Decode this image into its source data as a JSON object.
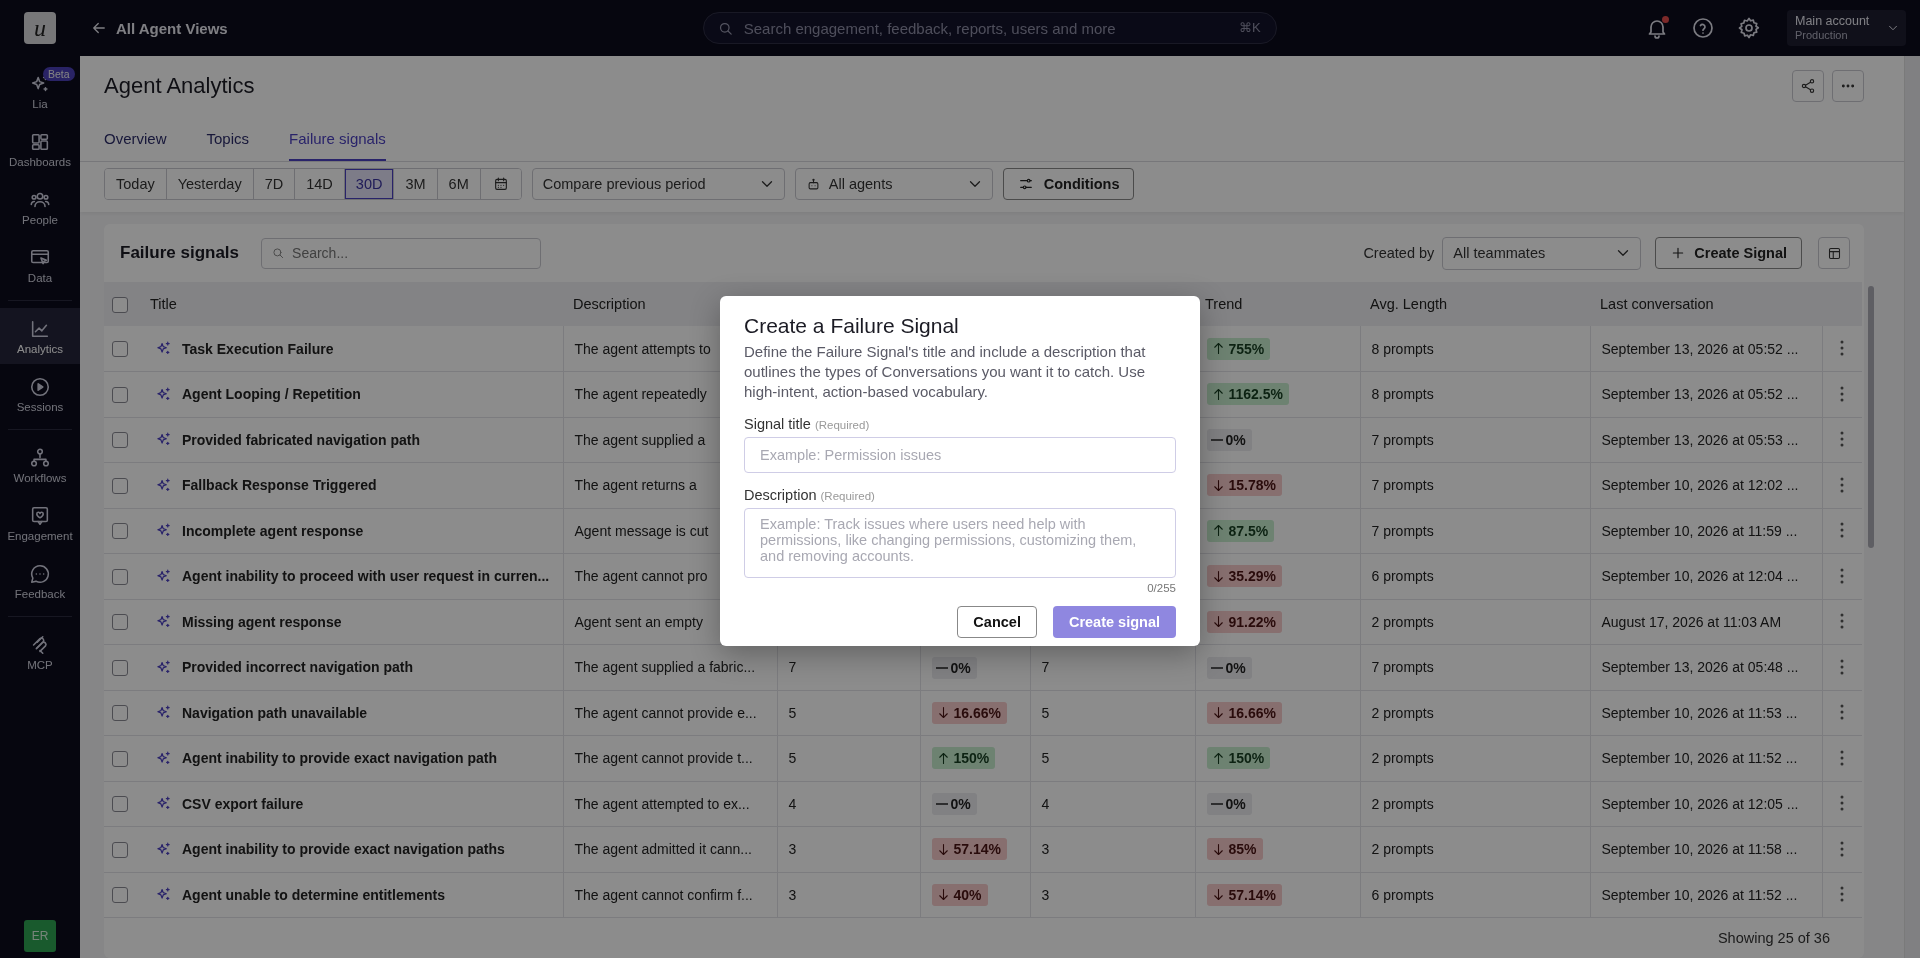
{
  "topbar": {
    "logo": "u",
    "back_link": "All Agent Views",
    "search": {
      "placeholder": "Search engagement, feedback, reports, users and more",
      "shortcut": "⌘K"
    },
    "notifications": {
      "unread": true
    },
    "account": {
      "name": "Main account",
      "environment": "Production"
    }
  },
  "sidebar": {
    "groups": [
      [
        {
          "label": "Lia",
          "badge": "Beta",
          "selected": false
        },
        {
          "label": "Dashboards",
          "selected": false
        },
        {
          "label": "People",
          "selected": false
        },
        {
          "label": "Data",
          "selected": false
        }
      ],
      [
        {
          "label": "Analytics",
          "selected": true
        },
        {
          "label": "Sessions",
          "selected": false
        }
      ],
      [
        {
          "label": "Workflows",
          "selected": false
        },
        {
          "label": "Engagement",
          "selected": false
        },
        {
          "label": "Feedback",
          "selected": false
        }
      ],
      [
        {
          "label": "MCP",
          "selected": false
        }
      ]
    ],
    "user_initials": "ER"
  },
  "page": {
    "title": "Agent Analytics",
    "tabs": [
      {
        "label": "Overview",
        "selected": false
      },
      {
        "label": "Topics",
        "selected": false
      },
      {
        "label": "Failure signals",
        "selected": true
      }
    ]
  },
  "filters": {
    "ranges": [
      {
        "label": "Today",
        "selected": false
      },
      {
        "label": "Yesterday",
        "selected": false
      },
      {
        "label": "7D",
        "selected": false
      },
      {
        "label": "14D",
        "selected": false
      },
      {
        "label": "30D",
        "selected": true
      },
      {
        "label": "3M",
        "selected": false
      },
      {
        "label": "6M",
        "selected": false
      }
    ],
    "compare": "Compare previous period",
    "agents": "All agents",
    "conditions": "Conditions"
  },
  "table_card": {
    "title": "Failure signals",
    "search_placeholder": "Search...",
    "created_by_label": "Created by",
    "created_by_value": "All teammates",
    "create_button": "Create Signal",
    "header": {
      "select_all_checked": false,
      "title": "Title",
      "description": "Description",
      "trend": "Trend",
      "avg_length": "Avg. Length",
      "last_conversation": "Last conversation"
    },
    "rows": [
      {
        "checked": false,
        "title": "Task Execution Failure",
        "description": "The agent attempts to",
        "trend": {
          "kind": "up",
          "value": "755%"
        },
        "avg_length": "8 prompts",
        "last_conversation": "September 13, 2026 at 05:52 ..."
      },
      {
        "checked": false,
        "title": "Agent Looping / Repetition",
        "description": "The agent repeatedly",
        "trend": {
          "kind": "up",
          "value": "1162.5%"
        },
        "avg_length": "8 prompts",
        "last_conversation": "September 13, 2026 at 05:52 ..."
      },
      {
        "checked": false,
        "title": "Provided fabricated navigation path",
        "description": "The agent supplied a",
        "trend": {
          "kind": "flat",
          "value": "0%"
        },
        "avg_length": "7 prompts",
        "last_conversation": "September 13, 2026 at 05:53 ..."
      },
      {
        "checked": false,
        "title": "Fallback Response Triggered",
        "description": "The agent returns a",
        "trend": {
          "kind": "down",
          "value": "15.78%"
        },
        "avg_length": "7 prompts",
        "last_conversation": "September 10, 2026 at 12:02 ..."
      },
      {
        "checked": false,
        "title": "Incomplete agent response",
        "description": "Agent message is cut",
        "trend": {
          "kind": "up",
          "value": "87.5%"
        },
        "avg_length": "7 prompts",
        "last_conversation": "September 10, 2026 at 11:59 ..."
      },
      {
        "checked": false,
        "title": "Agent inability to proceed with user request in curren...",
        "description": "The agent cannot pro",
        "trend": {
          "kind": "down",
          "value": "35.29%"
        },
        "avg_length": "6 prompts",
        "last_conversation": "September 10, 2026 at 12:04 ..."
      },
      {
        "checked": false,
        "title": "Missing agent response",
        "description": "Agent sent an empty",
        "trend": {
          "kind": "down",
          "value": "91.22%"
        },
        "avg_length": "2 prompts",
        "last_conversation": "August 17, 2026 at 11:03 AM"
      },
      {
        "checked": false,
        "title": "Provided incorrect navigation path",
        "description": "The agent supplied a fabric...",
        "column_3": "7",
        "column_4": {
          "kind": "flat",
          "value": "0%"
        },
        "column_5": "7",
        "trend": {
          "kind": "flat",
          "value": "0%"
        },
        "avg_length": "7 prompts",
        "last_conversation": "September 13, 2026 at 05:48 ..."
      },
      {
        "checked": false,
        "title": "Navigation path unavailable",
        "description": "The agent cannot provide e...",
        "column_3": "5",
        "column_4": {
          "kind": "down",
          "value": "16.66%"
        },
        "column_5": "5",
        "trend": {
          "kind": "down",
          "value": "16.66%"
        },
        "avg_length": "2 prompts",
        "last_conversation": "September 10, 2026 at 11:53 ..."
      },
      {
        "checked": false,
        "title": "Agent inability to provide exact navigation path",
        "description": "The agent cannot provide t...",
        "column_3": "5",
        "column_4": {
          "kind": "up",
          "value": "150%"
        },
        "column_5": "5",
        "trend": {
          "kind": "up",
          "value": "150%"
        },
        "avg_length": "2 prompts",
        "last_conversation": "September 10, 2026 at 11:52 ..."
      },
      {
        "checked": false,
        "title": "CSV export failure",
        "description": "The agent attempted to ex...",
        "column_3": "4",
        "column_4": {
          "kind": "flat",
          "value": "0%"
        },
        "column_5": "4",
        "trend": {
          "kind": "flat",
          "value": "0%"
        },
        "avg_length": "2 prompts",
        "last_conversation": "September 10, 2026 at 12:05 ..."
      },
      {
        "checked": false,
        "title": "Agent inability to provide exact navigation paths",
        "description": "The agent admitted it cann...",
        "column_3": "3",
        "column_4": {
          "kind": "down",
          "value": "57.14%"
        },
        "column_5": "3",
        "trend": {
          "kind": "down",
          "value": "85%"
        },
        "avg_length": "2 prompts",
        "last_conversation": "September 10, 2026 at 11:58 ..."
      },
      {
        "checked": false,
        "title": "Agent unable to determine entitlements",
        "description": "The agent cannot confirm f...",
        "column_3": "3",
        "column_4": {
          "kind": "down",
          "value": "40%"
        },
        "column_5": "3",
        "trend": {
          "kind": "down",
          "value": "57.14%"
        },
        "avg_length": "6 prompts",
        "last_conversation": "September 10, 2026 at 11:52 ..."
      }
    ],
    "footer": "Showing 25 of 36"
  },
  "modal": {
    "title": "Create a Failure Signal",
    "description": "Define the Failure Signal's title and include a description that outlines the types of Conversations you want it to catch. Use high-intent, action-based vocabulary.",
    "title_field": {
      "label": "Signal title",
      "hint": "(Required)",
      "placeholder": "Example: Permission issues"
    },
    "description_field": {
      "label": "Description",
      "hint": "(Required)",
      "placeholder": "Example: Track issues where users need help with permissions, like changing permissions, customizing them, and removing accounts.",
      "counter": "0/255"
    },
    "cancel": "Cancel",
    "submit": {
      "label": "Create signal",
      "disabled": true
    }
  }
}
